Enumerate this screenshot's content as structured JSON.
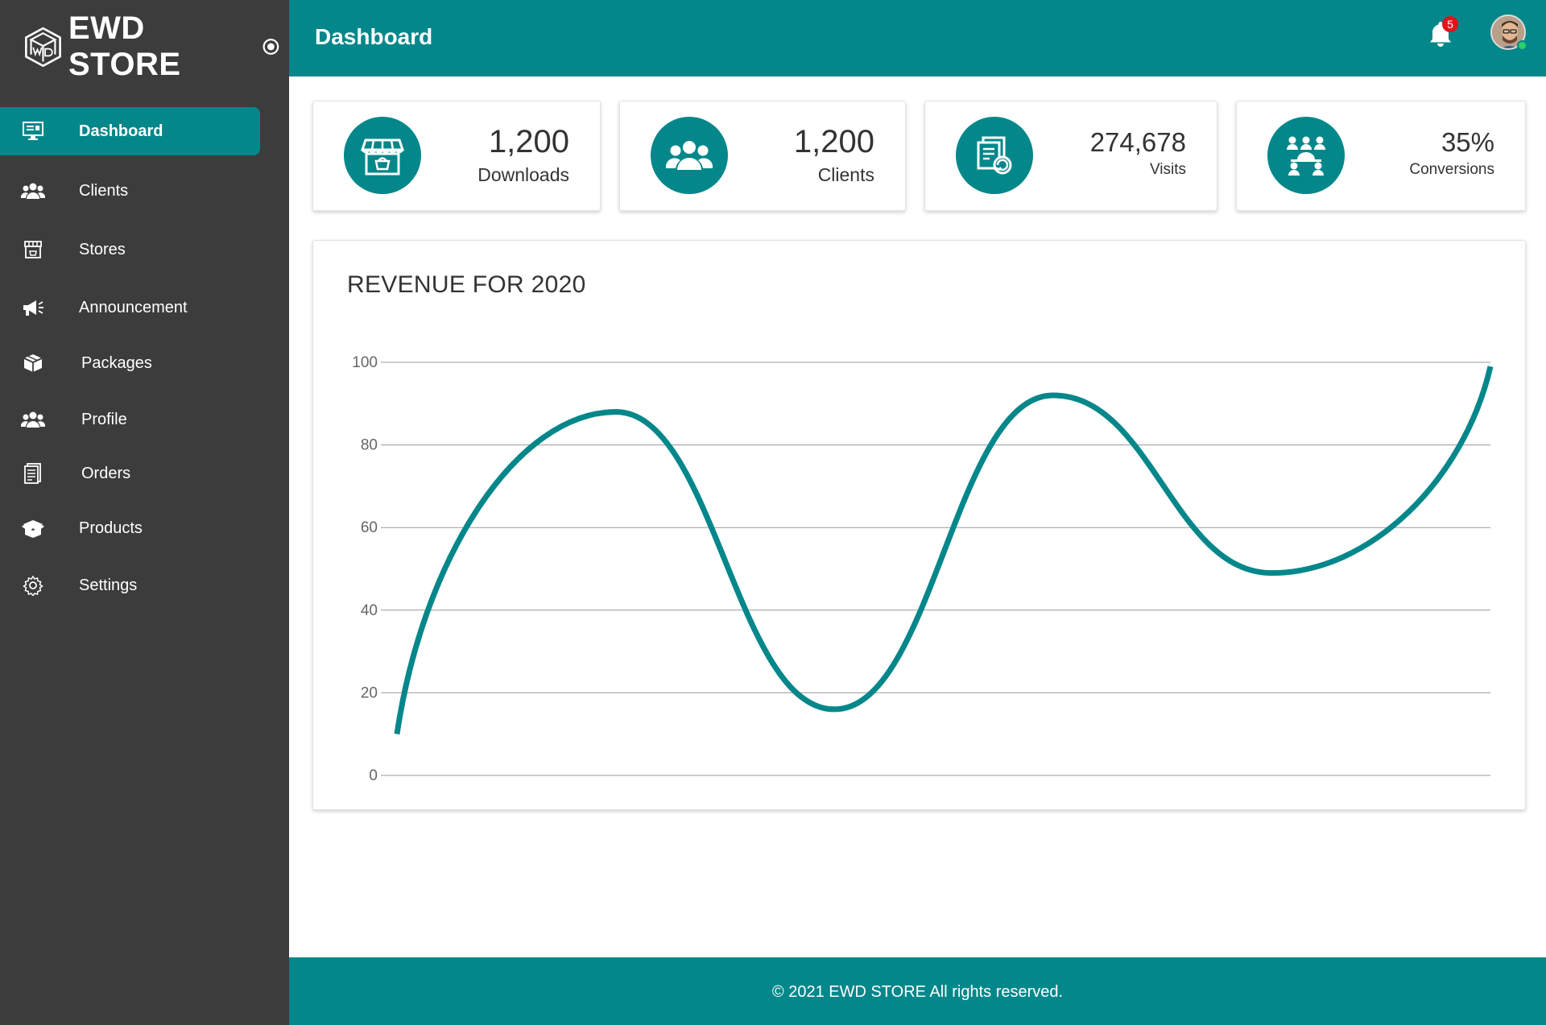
{
  "brand": {
    "name": "EWD STORE"
  },
  "sidebar": {
    "items": [
      {
        "label": "Dashboard",
        "icon": "dashboard-icon",
        "active": true
      },
      {
        "label": "Clients",
        "icon": "users-icon"
      },
      {
        "label": "Stores",
        "icon": "store-icon"
      },
      {
        "label": "Announcement",
        "icon": "megaphone-icon"
      },
      {
        "label": "Packages",
        "icon": "packages-icon"
      },
      {
        "label": "Profile",
        "icon": "profile-icon"
      },
      {
        "label": "Orders",
        "icon": "orders-icon"
      },
      {
        "label": "Products",
        "icon": "products-icon"
      },
      {
        "label": "Settings",
        "icon": "settings-icon"
      }
    ]
  },
  "header": {
    "title": "Dashboard",
    "notification_count": "5"
  },
  "stats": [
    {
      "value": "1,200",
      "caption": "Downloads",
      "icon": "store-basket-icon"
    },
    {
      "value": "1,200",
      "caption": "Clients",
      "icon": "clients-icon"
    },
    {
      "value": "274,678",
      "caption": "Visits",
      "icon": "visits-icon"
    },
    {
      "value": "35%",
      "caption": "Conversions",
      "icon": "conversions-icon"
    }
  ],
  "chart_data": {
    "type": "line",
    "title": "REVENUE FOR 2020",
    "xlabel": "",
    "ylabel": "",
    "ylim": [
      0,
      100
    ],
    "yticks": [
      "0",
      "20",
      "40",
      "60",
      "80",
      "100"
    ],
    "grid": true,
    "color": "#03878a",
    "x": [
      0,
      1,
      2,
      3,
      4,
      5
    ],
    "series": [
      {
        "values": [
          10,
          88,
          16,
          92,
          49,
          99
        ]
      }
    ]
  },
  "footer": {
    "text": "© 2021 EWD STORE  All rights reserved."
  },
  "colors": {
    "accent": "#03878a",
    "sidebar": "#3c3c3c",
    "badge": "#e2131d",
    "online": "#2ad06a"
  }
}
